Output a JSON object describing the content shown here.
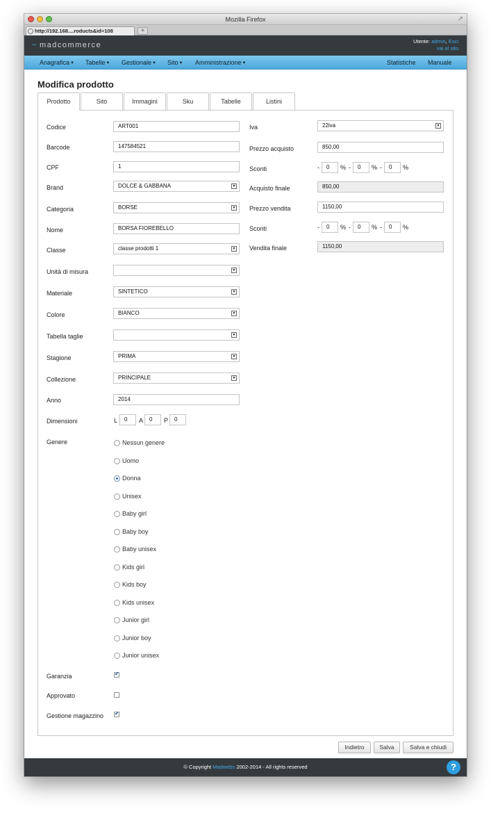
{
  "browser": {
    "title": "Mozilla Firefox",
    "tab_label": "http://192.168....roducts&id=108",
    "new_tab": "+"
  },
  "header": {
    "logo": "madcommerce",
    "user_prefix": "Utente:",
    "user_name": "admin",
    "logout": "Esci",
    "site_link": "vai al sito"
  },
  "nav": {
    "items": [
      "Anagrafica",
      "Tabelle",
      "Gestionale",
      "Sito",
      "Amministrazione"
    ],
    "right": [
      "Statistiche",
      "Manuale"
    ]
  },
  "page": {
    "title": "Modifica prodotto",
    "tabs": [
      "Prodotto",
      "Sito",
      "Immagini",
      "Sku",
      "Tabelle",
      "Listini"
    ],
    "active_tab": "Prodotto"
  },
  "form": {
    "codice": {
      "label": "Codice",
      "value": "ART001"
    },
    "barcode": {
      "label": "Barcode",
      "value": "147584521"
    },
    "cpf": {
      "label": "CPF",
      "value": "1"
    },
    "brand": {
      "label": "Brand",
      "value": "DOLCE & GABBANA"
    },
    "categoria": {
      "label": "Categoria",
      "value": "BORSE"
    },
    "nome": {
      "label": "Nome",
      "value": "BORSA FIOREBELLO"
    },
    "classe": {
      "label": "Classe",
      "value": "classe prodotti 1"
    },
    "unita": {
      "label": "Unità di misura",
      "value": ""
    },
    "materiale": {
      "label": "Materiale",
      "value": "SINTETICO"
    },
    "colore": {
      "label": "Colore",
      "value": "BIANCO"
    },
    "tabella_taglie": {
      "label": "Tabella taglie",
      "value": ""
    },
    "stagione": {
      "label": "Stagione",
      "value": "PRIMA"
    },
    "collezione": {
      "label": "Collezione",
      "value": "PRINCIPALE"
    },
    "anno": {
      "label": "Anno",
      "value": "2014"
    },
    "dimensioni": {
      "label": "Dimensioni",
      "l_label": "L",
      "l": "0",
      "a_label": "A",
      "a": "0",
      "p_label": "P",
      "p": "0"
    },
    "genere": {
      "label": "Genere",
      "options": [
        "Nessun genere",
        "Uomo",
        "Donna",
        "Unisex",
        "Baby girl",
        "Baby boy",
        "Baby unisex",
        "Kids girl",
        "Kids boy",
        "Kids unisex",
        "Junior girl",
        "Junior boy",
        "Junior unisex"
      ],
      "selected": "Donna"
    },
    "garanzia": {
      "label": "Garanzia",
      "checked": true
    },
    "approvato": {
      "label": "Approvato",
      "checked": false
    },
    "gestione_magazzino": {
      "label": "Gestione magazzino",
      "checked": true
    },
    "iva": {
      "label": "Iva",
      "value": "22iva"
    },
    "prezzo_acquisto": {
      "label": "Prezzo acquisto",
      "value": "850,00"
    },
    "sconti_acquisto": {
      "label": "Sconti",
      "values": [
        "0",
        "0",
        "0"
      ]
    },
    "acquisto_finale": {
      "label": "Acquisto finale",
      "value": "850,00"
    },
    "prezzo_vendita": {
      "label": "Prezzo vendita",
      "value": "1150,00"
    },
    "sconti_vendita": {
      "label": "Sconti",
      "values": [
        "0",
        "0",
        "0"
      ]
    },
    "vendita_finale": {
      "label": "Vendita finale",
      "value": "1150,00"
    },
    "sep_dash": "-",
    "sep_pct": "%"
  },
  "buttons": {
    "back": "Indietro",
    "save": "Salva",
    "save_close": "Salva e chiudi"
  },
  "footer": {
    "prefix": "© Copyright",
    "company": "Madwebs",
    "suffix": "2002-2014 - All rights reserved",
    "help": "?"
  }
}
